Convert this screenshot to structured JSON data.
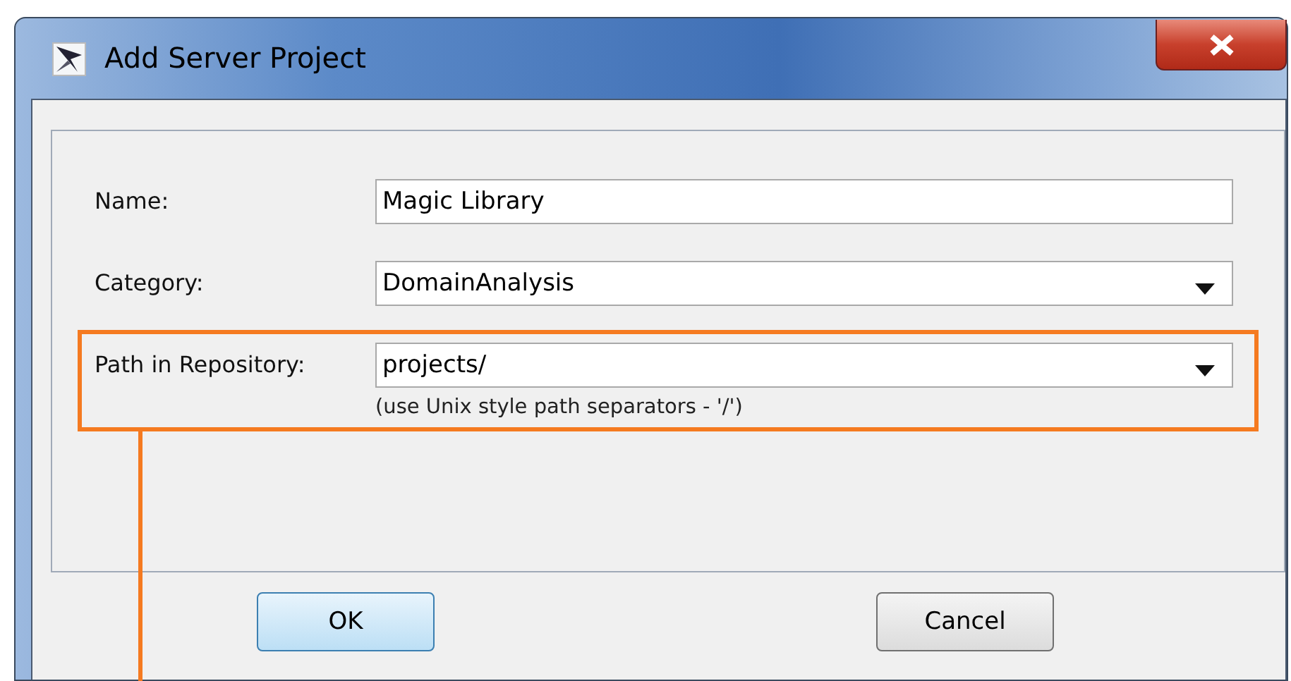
{
  "window": {
    "title": "Add Server Project"
  },
  "fields": [
    {
      "label": "Name:",
      "kind": "text",
      "value": "Magic Library",
      "highlighted": false
    },
    {
      "label": "Category:",
      "kind": "dropdown",
      "value": "DomainAnalysis",
      "highlighted": false
    },
    {
      "label": "Path in Repository:",
      "kind": "dropdown",
      "value": "projects/",
      "hint": "(use Unix style path separators - '/')",
      "highlighted": true
    }
  ],
  "buttons": [
    {
      "label": "OK",
      "default": true
    },
    {
      "label": "Cancel",
      "default": false
    }
  ]
}
